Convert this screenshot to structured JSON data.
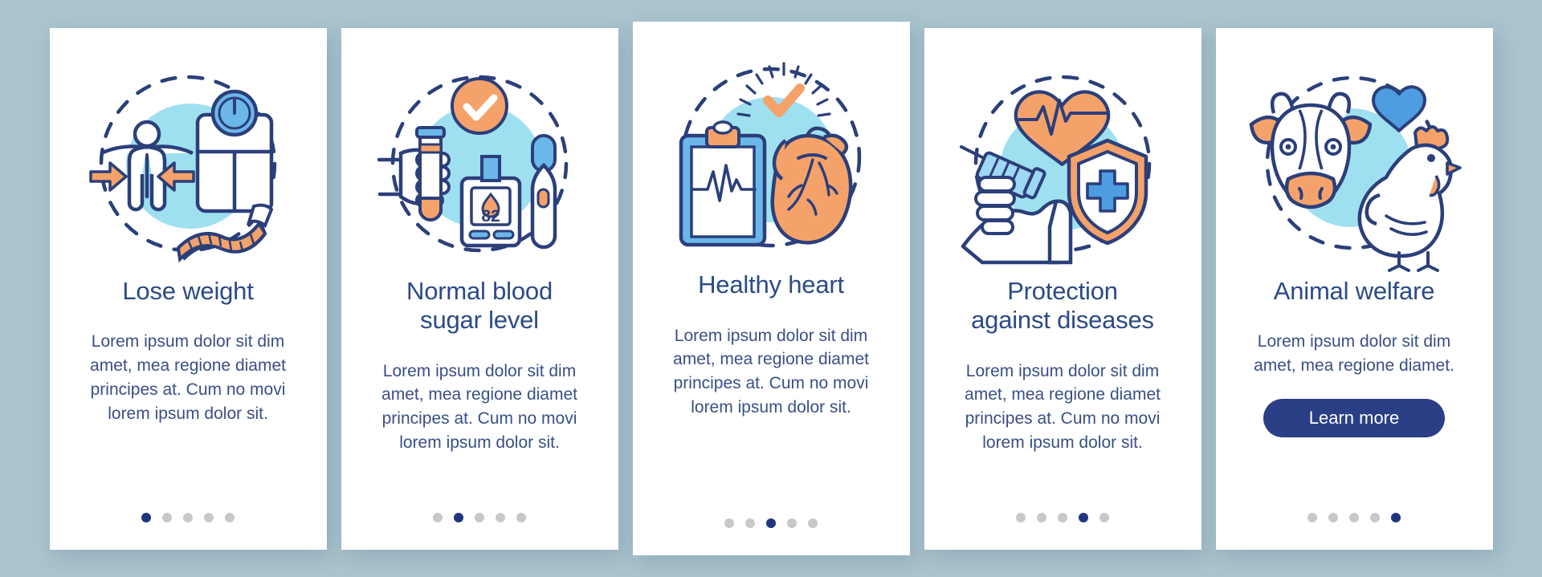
{
  "page": {
    "background_color": "#a9c4ce",
    "card_background": "#ffffff",
    "title_color": "#2c4a86",
    "body_color": "#3a4f86",
    "accent_navy": "#2a3f86",
    "accent_orange": "#f5a26a",
    "accent_blue": "#4d9de0",
    "accent_light_blue": "#9fe0f0",
    "dot_inactive": "#c6c9cc",
    "dot_active": "#1f3580"
  },
  "cards": [
    {
      "id": "lose-weight",
      "title": "Lose weight",
      "body": "Lorem ipsum dolor sit dim amet, mea regione diamet principes at. Cum no movi lorem ipsum dolor sit.",
      "illustration": "scale-person-tape-measure-icon",
      "dots": {
        "count": 5,
        "active_index": 0
      },
      "has_button": false
    },
    {
      "id": "normal-blood-sugar-level",
      "title": "Normal blood\nsugar level",
      "body": "Lorem ipsum dolor sit dim amet, mea regione diamet principes at. Cum no movi lorem ipsum dolor sit.",
      "illustration": "glucometer-blood-test-icon",
      "glucometer_reading": "82",
      "dots": {
        "count": 5,
        "active_index": 1
      },
      "has_button": false
    },
    {
      "id": "healthy-heart",
      "title": "Healthy heart",
      "body": "Lorem ipsum dolor sit dim amet, mea regione diamet principes at. Cum no movi lorem ipsum dolor sit.",
      "illustration": "clipboard-ecg-heart-icon",
      "dots": {
        "count": 5,
        "active_index": 2
      },
      "has_button": false
    },
    {
      "id": "protection-against-diseases",
      "title": "Protection\nagainst diseases",
      "body": "Lorem ipsum dolor sit dim amet, mea regione diamet principes at. Cum no movi lorem ipsum dolor sit.",
      "illustration": "syringe-shield-heartbeat-icon",
      "dots": {
        "count": 5,
        "active_index": 3
      },
      "has_button": false
    },
    {
      "id": "animal-welfare",
      "title": "Animal welfare",
      "body": "Lorem ipsum dolor sit dim amet, mea regione diamet.",
      "illustration": "cow-chicken-heart-icon",
      "dots": {
        "count": 5,
        "active_index": 4
      },
      "has_button": true,
      "button_label": "Learn more"
    }
  ]
}
